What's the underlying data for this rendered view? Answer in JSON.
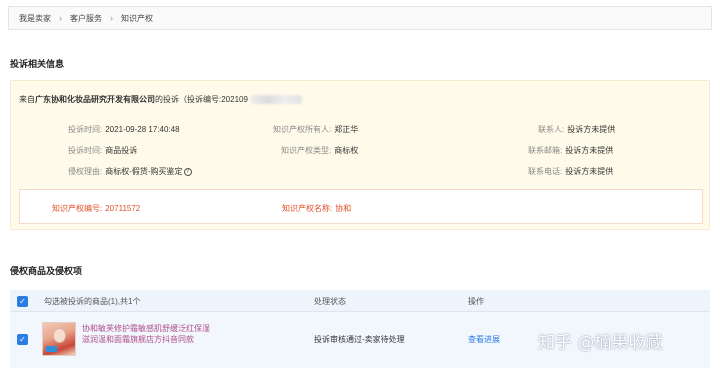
{
  "breadcrumb": [
    "我是卖家",
    "客户服务",
    "知识产权"
  ],
  "complaint_info": {
    "title": "投诉相关信息",
    "from_prefix": "来自",
    "company": "广东协和化妆品研究开发有限公司",
    "from_suffix": "的投诉（投诉编号:202109",
    "fields": {
      "complaint_time": {
        "label": "投诉时间:",
        "value": "2021-09-28 17:40:48"
      },
      "ip_owner": {
        "label": "知识产权所有人:",
        "value": "郑正华"
      },
      "contact": {
        "label": "联系人:",
        "value": "投诉方未提供"
      },
      "complaint_type": {
        "label": "投诉时间:",
        "value": "商品投诉"
      },
      "ip_type": {
        "label": "知识产权类型:",
        "value": "商标权"
      },
      "email": {
        "label": "联系邮箱:",
        "value": "投诉方未提供"
      },
      "reason": {
        "label": "侵权理由:",
        "value": "商标权-假货-购买鉴定"
      },
      "phone": {
        "label": "联系电话:",
        "value": "投诉方未提供"
      }
    },
    "ip_box": {
      "number": {
        "label": "知识产权编号:",
        "value": "20711572"
      },
      "name": {
        "label": "知识产权名称:",
        "value": "协和"
      }
    }
  },
  "infringing": {
    "title": "侵权商品及侵权项",
    "header": {
      "select_label": "勾选被投诉的商品(1),共1个",
      "status_label": "处理状态",
      "operation_label": "操作"
    },
    "rows": [
      {
        "name_line1": "协和敏芙修护霜敏感肌舒缓泛红保湿",
        "name_line2": "滋润温和面霜旗舰店方抖音同款",
        "status": "投诉审核通过-卖家待处理",
        "action": "查看进展"
      }
    ]
  },
  "watermark": "知乎 @楠果收藏",
  "colors": {
    "accent": "#2b7de1",
    "alert": "#e0502b",
    "notice_bg": "#fffbea",
    "product_link": "#b04e8c"
  }
}
